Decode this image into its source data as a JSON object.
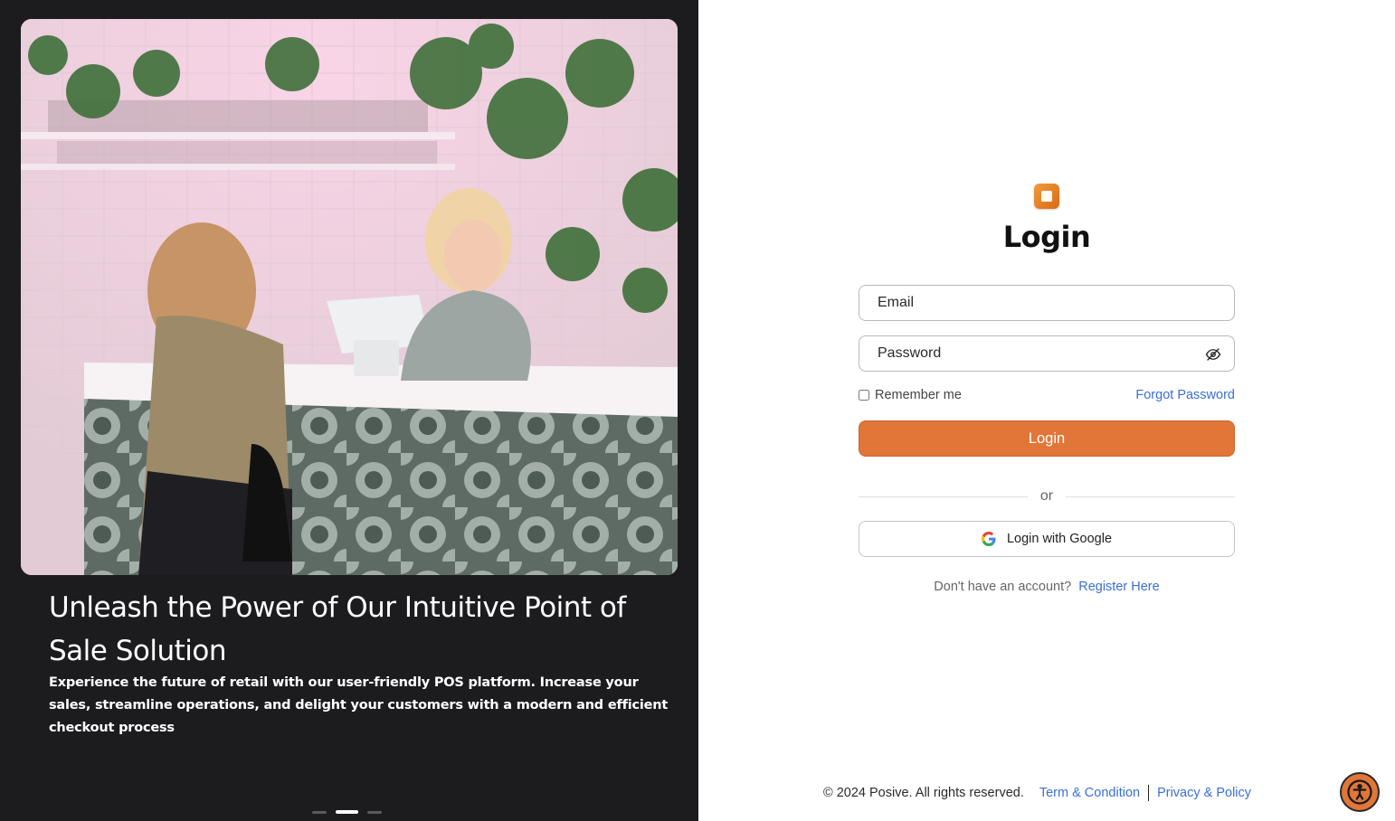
{
  "hero": {
    "headline": "Unleash the Power of Our Intuitive Point of Sale Solution",
    "subtext": "Experience the future of retail with our user-friendly POS platform. Increase your sales, streamline operations, and delight your customers with a modern and efficient checkout process",
    "slides": {
      "count": 3,
      "active_index": 1
    }
  },
  "login": {
    "title": "Login",
    "email_placeholder": "Email",
    "password_placeholder": "Password",
    "remember_label": "Remember me",
    "forgot_label": "Forgot Password",
    "submit_label": "Login",
    "divider_label": "or",
    "google_label": "Login with Google",
    "register_prompt": "Don't have an account?",
    "register_link": "Register Here"
  },
  "footer": {
    "copyright": "© 2024 Posive. All rights reserved.",
    "terms_link": "Term & Condition",
    "privacy_link": "Privacy & Policy"
  },
  "colors": {
    "accent": "#e07638",
    "link": "#3a6fd8",
    "left_panel_bg": "#1c1c1e"
  },
  "icons": [
    "app-logo-icon",
    "eye-off-icon",
    "google-icon",
    "accessibility-icon"
  ]
}
